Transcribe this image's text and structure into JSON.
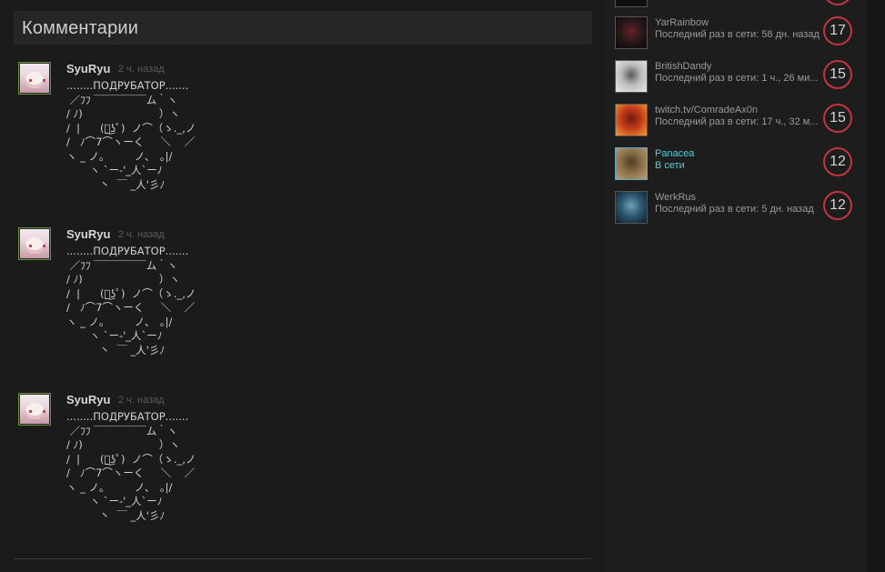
{
  "comments_section": {
    "title": "Комментарии"
  },
  "comments": [
    {
      "author": "SyuRyu",
      "time": "2 ч. назад",
      "text": "........ПОДРУБАТОР.......\n ／ﾌﾌ ￣￣￣￣￣ム｀ヽ\n/ ﾉ)                       ）ヽ\n/  |      (ﾟ͜ʖﾟ)  ノ⌒（ゝ._,ノ\n/   ﾉ⌒7⌒ヽーく     ＼    ／\nヽ _ ノ｡         ノ､   ｡|/\n       ヽ `ー-'_人`ーﾉ\n          丶  ￣ _人'彡ﾉ"
    },
    {
      "author": "SyuRyu",
      "time": "2 ч. назад",
      "text": "........ПОДРУБАТОР.......\n ／ﾌﾌ ￣￣￣￣￣ム｀ヽ\n/ ﾉ)                       ）ヽ\n/  |      (ﾟ͜ʖﾟ)  ノ⌒（ゝ._,ノ\n/   ﾉ⌒7⌒ヽーく     ＼    ／\nヽ _ ノ｡         ノ､   ｡|/\n       ヽ `ー-'_人`ーﾉ\n          丶  ￣ _人'彡ﾉ"
    },
    {
      "author": "SyuRyu",
      "time": "2 ч. назад",
      "text": "........ПОДРУБАТОР.......\n ／ﾌﾌ ￣￣￣￣￣ム｀ヽ\n/ ﾉ)                       ）ヽ\n/  |      (ﾟ͜ʖﾟ)  ノ⌒（ゝ._,ノ\n/   ﾉ⌒7⌒ヽーく     ＼    ／\nヽ _ ノ｡         ノ､   ｡|/\n       ヽ `ー-'_人`ーﾉ\n          丶  ￣ _人'彡ﾉ"
    }
  ],
  "friends": [
    {
      "name": "YarRainbow",
      "status": "Последний раз в сети: 58 дн. назад",
      "level": "17",
      "online": false,
      "avatar_colors": [
        "#0a0a0a",
        "#2b1a1a",
        "#6b1f26"
      ]
    },
    {
      "name": "BritishDandy",
      "status": "Последний раз в сети: 1 ч., 26 ми...",
      "level": "15",
      "online": false,
      "avatar_colors": [
        "#e8e8e8",
        "#bdbdbd",
        "#5a5a5a"
      ]
    },
    {
      "name": "twitch.tv/ComradeAx0n",
      "status": "Последний раз в сети: 17 ч., 32 м...",
      "level": "15",
      "online": false,
      "avatar_colors": [
        "#f0a030",
        "#c43a1a",
        "#6e1c10"
      ]
    },
    {
      "name": "Panacea",
      "status": "В сети",
      "level": "12",
      "online": true,
      "avatar_colors": [
        "#b7a07a",
        "#8a6e46",
        "#4e3c26"
      ]
    },
    {
      "name": "WerkRus",
      "status": "Последний раз в сети: 5 дн. назад",
      "level": "12",
      "online": false,
      "avatar_colors": [
        "#0e1c26",
        "#2e5a72",
        "#6fa0b6"
      ]
    }
  ],
  "colors": {
    "level_ring": "#c0353f",
    "online_text": "#57cbde",
    "offline_text": "#9a9a9a",
    "avatar_border_comment": "#6b8e3a"
  }
}
